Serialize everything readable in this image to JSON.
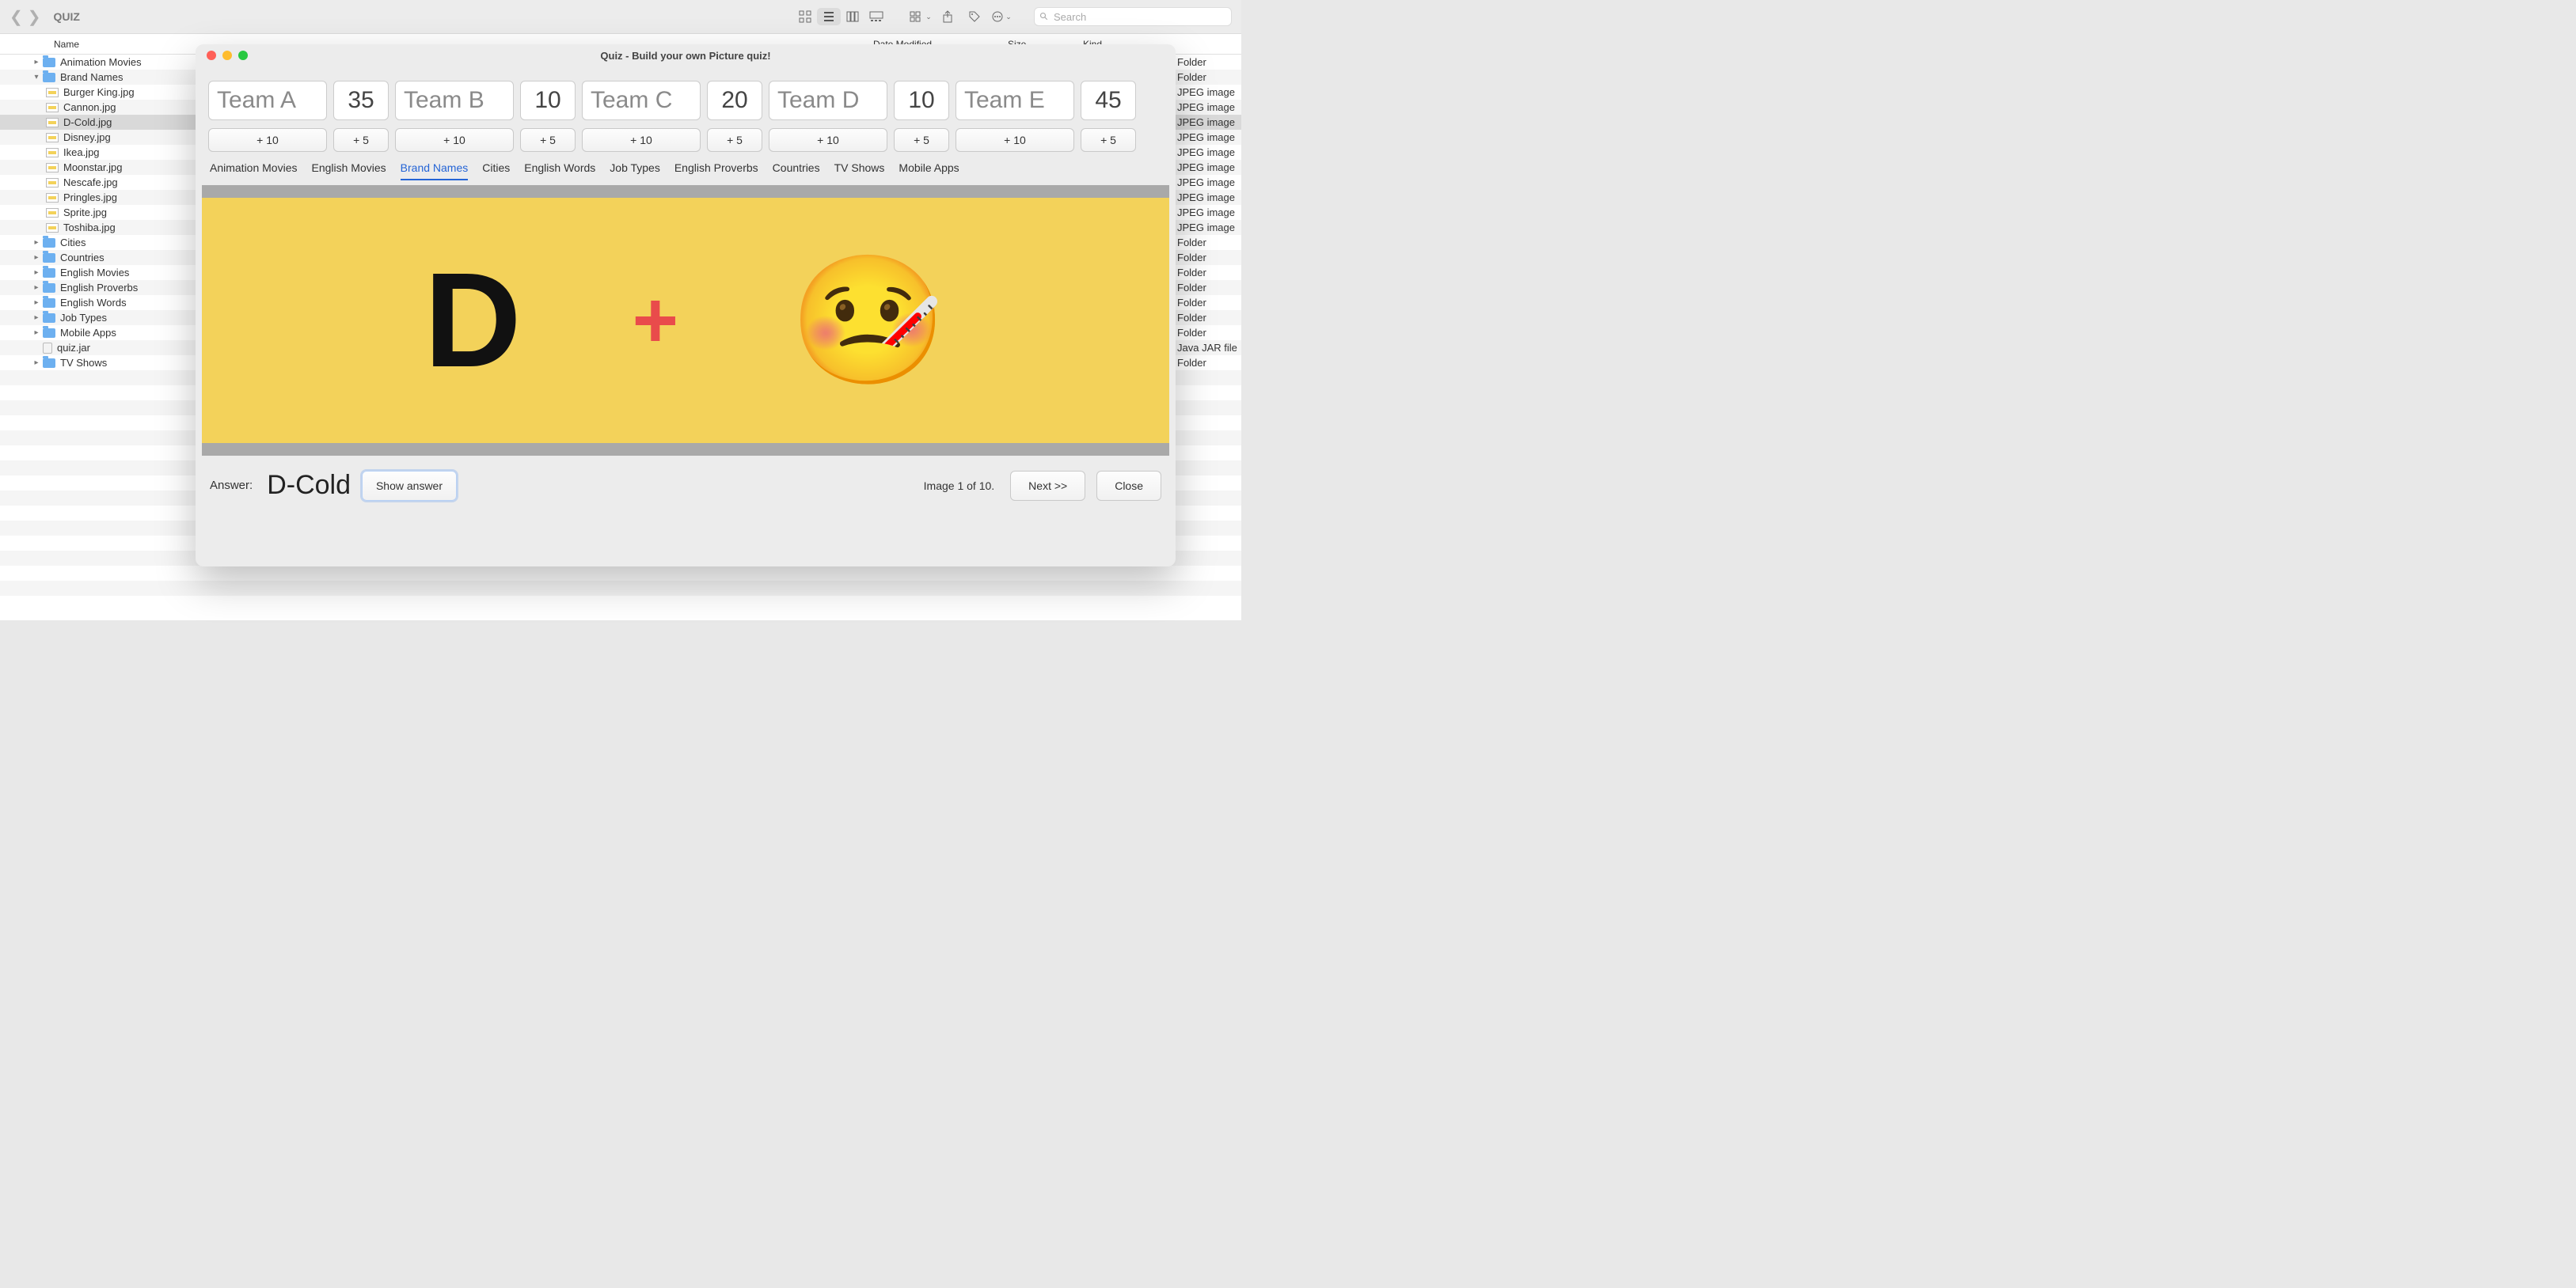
{
  "finder": {
    "title": "QUIZ",
    "search_placeholder": "Search",
    "columns": {
      "name": "Name",
      "date": "Date Modified",
      "size": "Size",
      "kind": "Kind"
    },
    "tree": [
      {
        "type": "folder",
        "name": "Animation Movies",
        "expanded": false,
        "kind": "Folder"
      },
      {
        "type": "folder",
        "name": "Brand Names",
        "expanded": true,
        "kind": "Folder"
      },
      {
        "type": "file",
        "name": "Burger King.jpg",
        "kind": "JPEG image",
        "indent": 1
      },
      {
        "type": "file",
        "name": "Cannon.jpg",
        "kind": "JPEG image",
        "indent": 1
      },
      {
        "type": "file",
        "name": "D-Cold.jpg",
        "kind": "JPEG image",
        "indent": 1,
        "selected": true
      },
      {
        "type": "file",
        "name": "Disney.jpg",
        "kind": "JPEG image",
        "indent": 1
      },
      {
        "type": "file",
        "name": "Ikea.jpg",
        "kind": "JPEG image",
        "indent": 1
      },
      {
        "type": "file",
        "name": "Moonstar.jpg",
        "kind": "JPEG image",
        "indent": 1
      },
      {
        "type": "file",
        "name": "Nescafe.jpg",
        "kind": "JPEG image",
        "indent": 1
      },
      {
        "type": "file",
        "name": "Pringles.jpg",
        "kind": "JPEG image",
        "indent": 1
      },
      {
        "type": "file",
        "name": "Sprite.jpg",
        "kind": "JPEG image",
        "indent": 1
      },
      {
        "type": "file",
        "name": "Toshiba.jpg",
        "kind": "JPEG image",
        "indent": 1
      },
      {
        "type": "folder",
        "name": "Cities",
        "expanded": false,
        "kind": "Folder"
      },
      {
        "type": "folder",
        "name": "Countries",
        "expanded": false,
        "kind": "Folder"
      },
      {
        "type": "folder",
        "name": "English Movies",
        "expanded": false,
        "kind": "Folder"
      },
      {
        "type": "folder",
        "name": "English Proverbs",
        "expanded": false,
        "kind": "Folder"
      },
      {
        "type": "folder",
        "name": "English Words",
        "expanded": false,
        "kind": "Folder"
      },
      {
        "type": "folder",
        "name": "Job Types",
        "expanded": false,
        "kind": "Folder"
      },
      {
        "type": "folder",
        "name": "Mobile Apps",
        "expanded": false,
        "kind": "Folder"
      },
      {
        "type": "jar",
        "name": "quiz.jar",
        "kind": "Java JAR file",
        "indent": 0
      },
      {
        "type": "folder",
        "name": "TV Shows",
        "expanded": false,
        "kind": "Folder"
      }
    ]
  },
  "quiz": {
    "window_title": "Quiz - Build your own Picture quiz!",
    "teams": [
      {
        "name": "Team A",
        "score": "35"
      },
      {
        "name": "Team B",
        "score": "10"
      },
      {
        "name": "Team C",
        "score": "20"
      },
      {
        "name": "Team D",
        "score": "10"
      },
      {
        "name": "Team E",
        "score": "45"
      }
    ],
    "plus10": "+ 10",
    "plus5": "+ 5",
    "categories": [
      "Animation Movies",
      "English Movies",
      "Brand Names",
      "Cities",
      "English Words",
      "Job Types",
      "English Proverbs",
      "Countries",
      "TV Shows",
      "Mobile Apps"
    ],
    "active_category": "Brand Names",
    "picture": {
      "letter": "D",
      "plus": "+",
      "emoji": "🤒"
    },
    "answer_label": "Answer:",
    "answer_text": "D-Cold",
    "show_answer": "Show answer",
    "status": "Image 1 of 10.",
    "next": "Next >>",
    "close": "Close"
  }
}
